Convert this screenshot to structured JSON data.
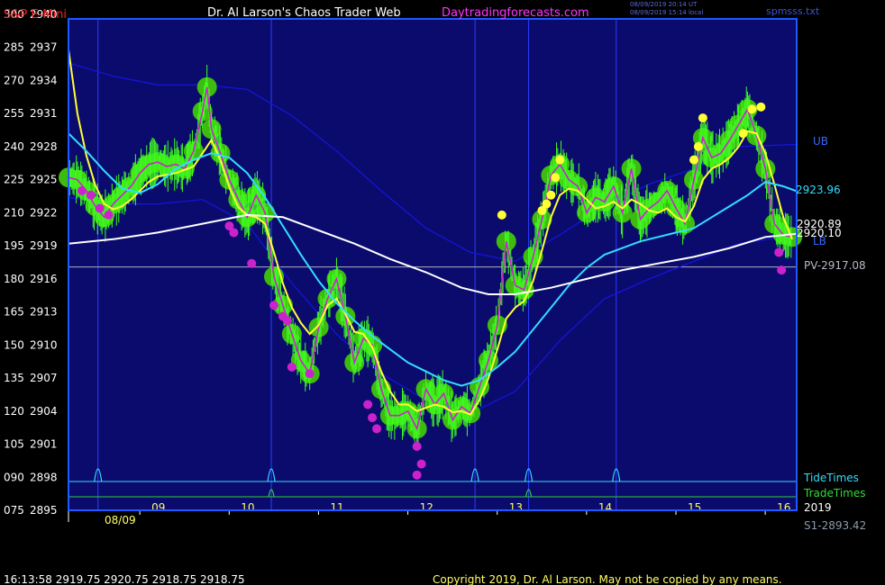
{
  "header": {
    "symbol": "S&P E-Mini",
    "title": "Dr. Al Larson's Chaos Trader Web",
    "site": "Daytradingforecasts.com",
    "timestamp_utc": "08/09/2019 20:14 UT",
    "timestamp_local": "08/09/2019 15:14 local",
    "file": "spmsss.txt"
  },
  "footer": {
    "quote": "16:13:58  2919.75 2920.75 2918.75 2918.75",
    "copyright": "Copyright 2019, Dr. Al Larson. May not be copied by any means."
  },
  "right_labels": {
    "ub": "UB",
    "lb": "LB",
    "upper_band_value": "2923.96",
    "value_1": "2920.89",
    "value_2": "2920.10",
    "pivot": "PV-2917.08",
    "support": "S1-2893.42",
    "tide_times": "TideTimes",
    "trade_times": "TradeTimes",
    "year": "2019"
  },
  "date_label": "08/09",
  "colors": {
    "background": "#000000",
    "plot_bg": "#0b0b6e",
    "frame": "#1e5aff",
    "price": "#3dbb10",
    "price_bright": "#40ff20",
    "magenta": "#cc22cc",
    "yellow": "#ffff33",
    "cyan": "#33ddff",
    "white": "#ffffff",
    "band": "#1515dd",
    "title_red": "#ff2020",
    "title_white": "#ffffff",
    "site_magenta": "#ff33ff",
    "pivot_line": "#b0b0c0"
  },
  "chart_data": {
    "type": "line",
    "x_unit": "hour of day (central time)",
    "xlim": [
      8.0,
      16.15
    ],
    "ylim": [
      2895,
      2940
    ],
    "y_ticks": [
      {
        "osc": "300",
        "price": 2940
      },
      {
        "osc": "285",
        "price": 2937
      },
      {
        "osc": "270",
        "price": 2934
      },
      {
        "osc": "255",
        "price": 2931
      },
      {
        "osc": "240",
        "price": 2928
      },
      {
        "osc": "225",
        "price": 2925
      },
      {
        "osc": "210",
        "price": 2922
      },
      {
        "osc": "195",
        "price": 2919
      },
      {
        "osc": "180",
        "price": 2916
      },
      {
        "osc": "165",
        "price": 2913
      },
      {
        "osc": "150",
        "price": 2910
      },
      {
        "osc": "135",
        "price": 2907
      },
      {
        "osc": "120",
        "price": 2904
      },
      {
        "osc": "105",
        "price": 2901
      },
      {
        "osc": "090",
        "price": 2898
      },
      {
        "osc": "075",
        "price": 2895
      }
    ],
    "x_ticks": [
      {
        "label": "09",
        "x": 9
      },
      {
        "label": "10",
        "x": 10
      },
      {
        "label": "11",
        "x": 11
      },
      {
        "label": "12",
        "x": 12
      },
      {
        "label": "13",
        "x": 13
      },
      {
        "label": "14",
        "x": 14
      },
      {
        "label": "15",
        "x": 15
      },
      {
        "label": "16",
        "x": 16
      }
    ],
    "tide_times": [
      8.33,
      10.27,
      12.55,
      13.15,
      14.13
    ],
    "trade_times": [
      10.27,
      13.15
    ],
    "pivot": 2917.08,
    "price": [
      [
        8.0,
        2925.2
      ],
      [
        8.1,
        2925.0
      ],
      [
        8.2,
        2924.0
      ],
      [
        8.3,
        2922.6
      ],
      [
        8.4,
        2921.6
      ],
      [
        8.5,
        2922.8
      ],
      [
        8.6,
        2923.6
      ],
      [
        8.7,
        2924.4
      ],
      [
        8.8,
        2925.6
      ],
      [
        8.9,
        2926.4
      ],
      [
        9.0,
        2926.6
      ],
      [
        9.1,
        2926.2
      ],
      [
        9.2,
        2926.4
      ],
      [
        9.3,
        2926.0
      ],
      [
        9.4,
        2927.6
      ],
      [
        9.5,
        2931.2
      ],
      [
        9.55,
        2933.4
      ],
      [
        9.6,
        2929.6
      ],
      [
        9.7,
        2927.4
      ],
      [
        9.8,
        2925.0
      ],
      [
        9.9,
        2923.2
      ],
      [
        10.0,
        2921.6
      ],
      [
        10.1,
        2923.6
      ],
      [
        10.2,
        2922.0
      ],
      [
        10.3,
        2916.2
      ],
      [
        10.4,
        2913.6
      ],
      [
        10.5,
        2911.0
      ],
      [
        10.6,
        2908.6
      ],
      [
        10.7,
        2907.4
      ],
      [
        10.8,
        2911.6
      ],
      [
        10.9,
        2914.2
      ],
      [
        11.0,
        2916.0
      ],
      [
        11.1,
        2912.6
      ],
      [
        11.2,
        2908.4
      ],
      [
        11.3,
        2910.6
      ],
      [
        11.4,
        2910.0
      ],
      [
        11.5,
        2906.0
      ],
      [
        11.6,
        2903.6
      ],
      [
        11.7,
        2903.6
      ],
      [
        11.8,
        2904.0
      ],
      [
        11.9,
        2902.4
      ],
      [
        12.0,
        2906.0
      ],
      [
        12.1,
        2904.6
      ],
      [
        12.2,
        2905.6
      ],
      [
        12.3,
        2903.2
      ],
      [
        12.4,
        2904.4
      ],
      [
        12.5,
        2903.8
      ],
      [
        12.6,
        2906.2
      ],
      [
        12.7,
        2908.6
      ],
      [
        12.8,
        2911.8
      ],
      [
        12.9,
        2919.4
      ],
      [
        13.0,
        2915.4
      ],
      [
        13.1,
        2915.0
      ],
      [
        13.2,
        2918.0
      ],
      [
        13.3,
        2921.4
      ],
      [
        13.4,
        2925.4
      ],
      [
        13.5,
        2926.4
      ],
      [
        13.6,
        2925.0
      ],
      [
        13.7,
        2924.4
      ],
      [
        13.8,
        2922.0
      ],
      [
        13.9,
        2923.4
      ],
      [
        14.0,
        2923.0
      ],
      [
        14.1,
        2924.4
      ],
      [
        14.2,
        2922.0
      ],
      [
        14.3,
        2926.0
      ],
      [
        14.4,
        2921.4
      ],
      [
        14.5,
        2922.4
      ],
      [
        14.6,
        2923.0
      ],
      [
        14.7,
        2924.0
      ],
      [
        14.8,
        2922.4
      ],
      [
        14.9,
        2921.0
      ],
      [
        15.0,
        2925.0
      ],
      [
        15.1,
        2928.8
      ],
      [
        15.2,
        2927.0
      ],
      [
        15.3,
        2927.4
      ],
      [
        15.4,
        2928.6
      ],
      [
        15.5,
        2930.0
      ],
      [
        15.6,
        2931.4
      ],
      [
        15.7,
        2929.0
      ],
      [
        15.8,
        2926.0
      ],
      [
        15.9,
        2921.0
      ],
      [
        16.0,
        2920.0
      ],
      [
        16.1,
        2919.8
      ]
    ],
    "series": [
      {
        "color": "yellow",
        "points": [
          [
            8.0,
            2936.8
          ],
          [
            8.1,
            2931.0
          ],
          [
            8.2,
            2927.2
          ],
          [
            8.3,
            2924.5
          ],
          [
            8.4,
            2922.8
          ],
          [
            8.5,
            2922.3
          ],
          [
            8.6,
            2922.6
          ],
          [
            8.7,
            2923.2
          ],
          [
            8.8,
            2924.0
          ],
          [
            8.9,
            2924.8
          ],
          [
            9.0,
            2925.3
          ],
          [
            9.2,
            2925.6
          ],
          [
            9.4,
            2926.2
          ],
          [
            9.5,
            2927.4
          ],
          [
            9.6,
            2928.6
          ],
          [
            9.7,
            2926.8
          ],
          [
            9.8,
            2924.3
          ],
          [
            9.9,
            2922.5
          ],
          [
            10.0,
            2921.8
          ],
          [
            10.1,
            2921.6
          ],
          [
            10.2,
            2921.0
          ],
          [
            10.3,
            2918.4
          ],
          [
            10.4,
            2915.6
          ],
          [
            10.5,
            2913.4
          ],
          [
            10.6,
            2912.0
          ],
          [
            10.7,
            2911.0
          ],
          [
            10.8,
            2911.8
          ],
          [
            10.9,
            2913.6
          ],
          [
            11.0,
            2914.2
          ],
          [
            11.1,
            2912.8
          ],
          [
            11.2,
            2911.2
          ],
          [
            11.3,
            2911.0
          ],
          [
            11.4,
            2909.8
          ],
          [
            11.5,
            2907.6
          ],
          [
            11.6,
            2905.8
          ],
          [
            11.7,
            2904.6
          ],
          [
            11.8,
            2904.6
          ],
          [
            11.9,
            2904.0
          ],
          [
            12.0,
            2904.3
          ],
          [
            12.1,
            2904.6
          ],
          [
            12.2,
            2904.4
          ],
          [
            12.3,
            2903.9
          ],
          [
            12.4,
            2904.0
          ],
          [
            12.5,
            2903.7
          ],
          [
            12.6,
            2905.0
          ],
          [
            12.7,
            2907.0
          ],
          [
            12.8,
            2909.6
          ],
          [
            12.9,
            2912.4
          ],
          [
            13.0,
            2913.4
          ],
          [
            13.1,
            2914.0
          ],
          [
            13.2,
            2915.8
          ],
          [
            13.3,
            2918.6
          ],
          [
            13.4,
            2921.6
          ],
          [
            13.5,
            2923.6
          ],
          [
            13.6,
            2924.2
          ],
          [
            13.7,
            2924.0
          ],
          [
            13.8,
            2923.2
          ],
          [
            13.9,
            2922.4
          ],
          [
            14.0,
            2922.6
          ],
          [
            14.1,
            2923.0
          ],
          [
            14.2,
            2922.4
          ],
          [
            14.3,
            2923.2
          ],
          [
            14.4,
            2922.8
          ],
          [
            14.5,
            2922.2
          ],
          [
            14.6,
            2922.0
          ],
          [
            14.7,
            2922.4
          ],
          [
            14.8,
            2921.6
          ],
          [
            14.9,
            2921.2
          ],
          [
            15.0,
            2922.6
          ],
          [
            15.1,
            2925.0
          ],
          [
            15.2,
            2926.0
          ],
          [
            15.3,
            2926.4
          ],
          [
            15.4,
            2927.0
          ],
          [
            15.5,
            2928.0
          ],
          [
            15.6,
            2929.4
          ],
          [
            15.7,
            2929.2
          ],
          [
            15.8,
            2927.4
          ],
          [
            15.9,
            2924.6
          ],
          [
            16.0,
            2921.6
          ],
          [
            16.1,
            2919.6
          ]
        ]
      },
      {
        "color": "cyan",
        "points": [
          [
            8.0,
            2929.2
          ],
          [
            8.2,
            2927.6
          ],
          [
            8.4,
            2925.8
          ],
          [
            8.6,
            2924.2
          ],
          [
            8.8,
            2923.8
          ],
          [
            9.0,
            2924.6
          ],
          [
            9.2,
            2926.0
          ],
          [
            9.4,
            2926.8
          ],
          [
            9.6,
            2927.4
          ],
          [
            9.8,
            2927.0
          ],
          [
            10.0,
            2925.6
          ],
          [
            10.2,
            2923.4
          ],
          [
            10.4,
            2920.8
          ],
          [
            10.6,
            2918.2
          ],
          [
            10.8,
            2915.8
          ],
          [
            11.0,
            2913.8
          ],
          [
            11.2,
            2912.2
          ],
          [
            11.4,
            2910.8
          ],
          [
            11.6,
            2909.6
          ],
          [
            11.8,
            2908.4
          ],
          [
            12.0,
            2907.6
          ],
          [
            12.2,
            2906.8
          ],
          [
            12.4,
            2906.3
          ],
          [
            12.6,
            2906.8
          ],
          [
            12.8,
            2908.0
          ],
          [
            13.0,
            2909.4
          ],
          [
            13.2,
            2911.4
          ],
          [
            13.4,
            2913.4
          ],
          [
            13.6,
            2915.4
          ],
          [
            13.8,
            2917.0
          ],
          [
            14.0,
            2918.2
          ],
          [
            14.2,
            2918.8
          ],
          [
            14.4,
            2919.4
          ],
          [
            14.6,
            2919.8
          ],
          [
            14.8,
            2920.2
          ],
          [
            15.0,
            2920.6
          ],
          [
            15.2,
            2921.6
          ],
          [
            15.4,
            2922.6
          ],
          [
            15.6,
            2923.6
          ],
          [
            15.8,
            2924.8
          ],
          [
            16.0,
            2924.4
          ],
          [
            16.15,
            2923.96
          ]
        ]
      },
      {
        "color": "white",
        "points": [
          [
            8.0,
            2919.2
          ],
          [
            8.5,
            2919.6
          ],
          [
            9.0,
            2920.2
          ],
          [
            9.5,
            2921.0
          ],
          [
            10.0,
            2921.8
          ],
          [
            10.4,
            2921.6
          ],
          [
            10.8,
            2920.4
          ],
          [
            11.2,
            2919.2
          ],
          [
            11.6,
            2917.8
          ],
          [
            12.0,
            2916.6
          ],
          [
            12.4,
            2915.2
          ],
          [
            12.7,
            2914.6
          ],
          [
            13.0,
            2914.6
          ],
          [
            13.4,
            2915.2
          ],
          [
            13.8,
            2916.0
          ],
          [
            14.2,
            2916.8
          ],
          [
            14.6,
            2917.4
          ],
          [
            15.0,
            2918.0
          ],
          [
            15.4,
            2918.8
          ],
          [
            15.8,
            2919.8
          ],
          [
            16.15,
            2920.1
          ]
        ]
      },
      {
        "color": "band",
        "points": [
          [
            8.0,
            2935.6
          ],
          [
            8.5,
            2934.4
          ],
          [
            9.0,
            2933.6
          ],
          [
            9.5,
            2933.6
          ],
          [
            10.0,
            2933.2
          ],
          [
            10.5,
            2930.8
          ],
          [
            11.0,
            2927.6
          ],
          [
            11.5,
            2924.0
          ],
          [
            12.0,
            2920.6
          ],
          [
            12.5,
            2918.4
          ],
          [
            13.0,
            2917.6
          ],
          [
            13.5,
            2920.0
          ],
          [
            14.0,
            2922.6
          ],
          [
            14.5,
            2924.6
          ],
          [
            15.0,
            2926.0
          ],
          [
            15.5,
            2928.0
          ],
          [
            16.15,
            2928.2
          ]
        ]
      },
      {
        "color": "band",
        "points": [
          [
            8.0,
            2923.4
          ],
          [
            8.5,
            2922.8
          ],
          [
            9.0,
            2922.8
          ],
          [
            9.5,
            2923.2
          ],
          [
            10.0,
            2921.0
          ],
          [
            10.5,
            2915.6
          ],
          [
            11.0,
            2911.0
          ],
          [
            11.5,
            2907.4
          ],
          [
            12.0,
            2905.0
          ],
          [
            12.5,
            2903.8
          ],
          [
            13.0,
            2905.8
          ],
          [
            13.5,
            2910.4
          ],
          [
            14.0,
            2914.2
          ],
          [
            14.5,
            2916.0
          ],
          [
            15.0,
            2917.6
          ],
          [
            15.5,
            2919.2
          ],
          [
            16.15,
            2920.0
          ]
        ]
      }
    ],
    "magenta_dots": [
      [
        8.15,
        2924.0
      ],
      [
        8.25,
        2923.6
      ],
      [
        8.35,
        2922.4
      ],
      [
        8.45,
        2921.8
      ],
      [
        9.8,
        2920.8
      ],
      [
        9.85,
        2920.2
      ],
      [
        10.05,
        2917.4
      ],
      [
        10.3,
        2913.6
      ],
      [
        10.4,
        2912.6
      ],
      [
        10.45,
        2912.2
      ],
      [
        10.5,
        2908.0
      ],
      [
        10.7,
        2907.4
      ],
      [
        11.35,
        2904.6
      ],
      [
        11.4,
        2903.4
      ],
      [
        11.45,
        2902.4
      ],
      [
        11.9,
        2900.8
      ],
      [
        11.95,
        2899.2
      ],
      [
        11.9,
        2898.2
      ],
      [
        15.95,
        2918.4
      ],
      [
        15.98,
        2916.8
      ]
    ],
    "yellow_dots": [
      [
        12.85,
        2921.8
      ],
      [
        13.3,
        2922.2
      ],
      [
        13.35,
        2922.8
      ],
      [
        13.4,
        2923.6
      ],
      [
        13.45,
        2925.2
      ],
      [
        13.5,
        2926.8
      ],
      [
        15.0,
        2926.8
      ],
      [
        15.05,
        2928.0
      ],
      [
        15.1,
        2930.6
      ],
      [
        15.55,
        2929.2
      ],
      [
        15.65,
        2931.4
      ],
      [
        15.75,
        2931.6
      ]
    ]
  }
}
